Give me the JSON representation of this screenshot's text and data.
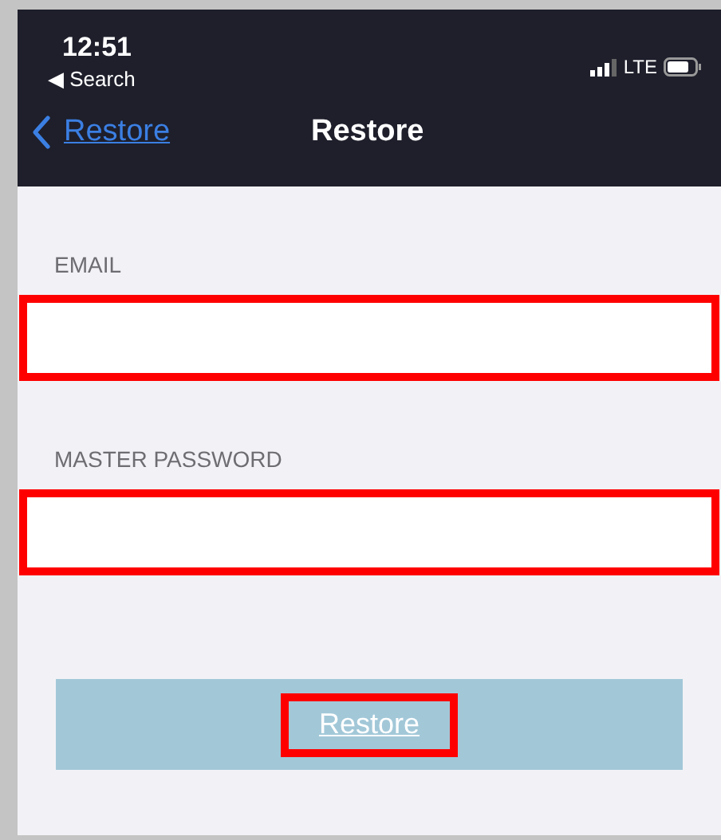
{
  "status_bar": {
    "time": "12:51",
    "back_app": "◀ Search",
    "network": "LTE"
  },
  "nav_bar": {
    "back": {
      "label": "Restore"
    },
    "title": "Restore"
  },
  "fields": [
    {
      "label": "EMAIL",
      "highlighted": true
    },
    {
      "label": "MASTER PASSWORD",
      "highlighted": true
    }
  ],
  "button": {
    "label": "Restore",
    "highlighted": true
  }
}
